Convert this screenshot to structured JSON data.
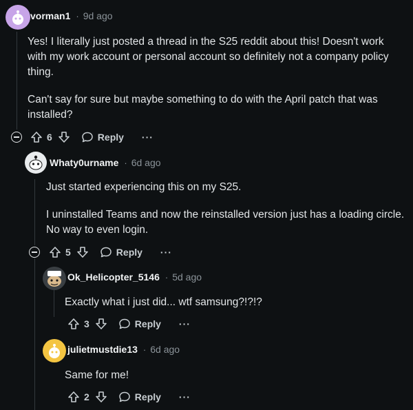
{
  "comments": [
    {
      "username": "vorman1",
      "time": "9d ago",
      "paragraphs": [
        "Yes! I literally just posted a thread in the S25 reddit about this! Doesn't work with my work account or personal account so definitely not a company policy thing.",
        "Can't say for sure but maybe something to do with the April patch that was installed?"
      ],
      "votes": "6",
      "reply_label": "Reply",
      "more_label": "···"
    },
    {
      "username": "Whaty0urname",
      "time": "6d ago",
      "paragraphs": [
        "Just started experiencing this on my S25.",
        "I uninstalled Teams and now the reinstalled version just has a loading circle. No way to even login."
      ],
      "votes": "5",
      "reply_label": "Reply",
      "more_label": "···"
    },
    {
      "username": "Ok_Helicopter_5146",
      "time": "5d ago",
      "paragraphs": [
        "Exactly what i just did... wtf samsung?!?!?"
      ],
      "votes": "3",
      "reply_label": "Reply",
      "more_label": "···"
    },
    {
      "username": "julietmustdie13",
      "time": "6d ago",
      "paragraphs": [
        "Same for me!"
      ],
      "votes": "2",
      "reply_label": "Reply",
      "more_label": "···"
    }
  ],
  "separator": "·",
  "colors": {
    "background": "#0e1113",
    "text": "#e3e6e8",
    "muted": "#8b9399",
    "avatar1": "#c7a4e8",
    "avatar4": "#f4c542"
  }
}
